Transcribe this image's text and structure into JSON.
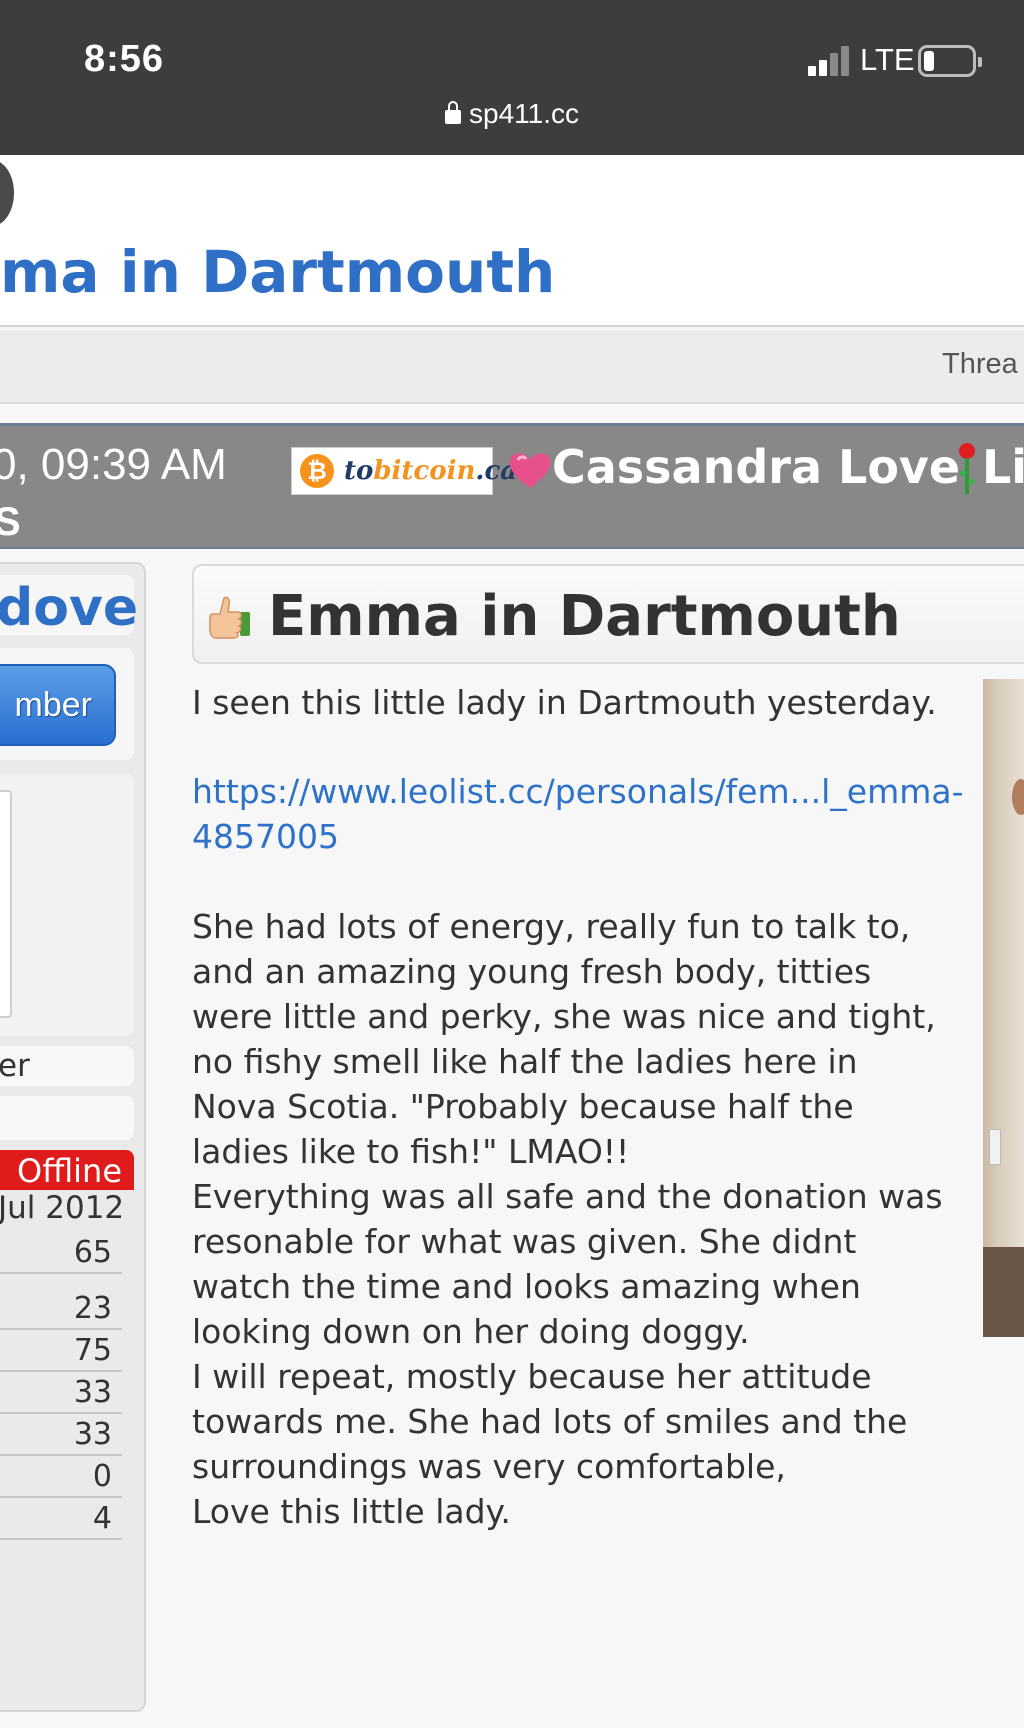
{
  "status_bar": {
    "time": "8:56",
    "network": "LTE",
    "url": "sp411.cc"
  },
  "page": {
    "thread_title": "ma in Dartmouth",
    "thread_bar_label": "Threa"
  },
  "post_header": {
    "date_text": "0, 09:39 AM",
    "date_line2": "S",
    "banner_text_prefix": "to",
    "banner_text_accent": "bitcoin",
    "banner_text_suffix": ".ca",
    "ad_name": "Cassandra Love",
    "ad_name_tail": "Li"
  },
  "user_panel": {
    "username": "dove",
    "member_button": "mber",
    "user_title": "er",
    "status": "Offline",
    "join_date": "Jul 2012",
    "stats": [
      "65",
      "23",
      "75",
      "33",
      "33",
      "0",
      "4"
    ]
  },
  "post": {
    "title": "Emma in Dartmouth",
    "intro": "I seen this little lady in Dartmouth yesterday.",
    "link": "https://www.leolist.cc/personals/fem...l_emma-4857005",
    "body_lines": [
      "She had lots of energy, really fun to talk to,",
      "and an amazing young fresh body, titties",
      "were little and perky, she was nice and tight,",
      "no fishy smell like half the ladies here in",
      "Nova Scotia. \"Probably because half the",
      "ladies like to fish!\" LMAO!!",
      "Everything was all safe and the donation was",
      "resonable for what was given. She didnt",
      "watch the time and looks amazing when",
      "looking down on her doing doggy.",
      "I will repeat, mostly because her attitude",
      "towards me. She had lots of smiles and the",
      "surroundings was very comfortable,",
      "Love this little lady."
    ]
  },
  "colors": {
    "link_blue": "#2f6fc6",
    "offline_red": "#e01b1b",
    "header_band": "#888888"
  },
  "icons": [
    "lock-icon",
    "signal-icon",
    "battery-icon",
    "bitcoin-icon",
    "heart-icon",
    "rose-icon",
    "thumbs-up-icon"
  ]
}
